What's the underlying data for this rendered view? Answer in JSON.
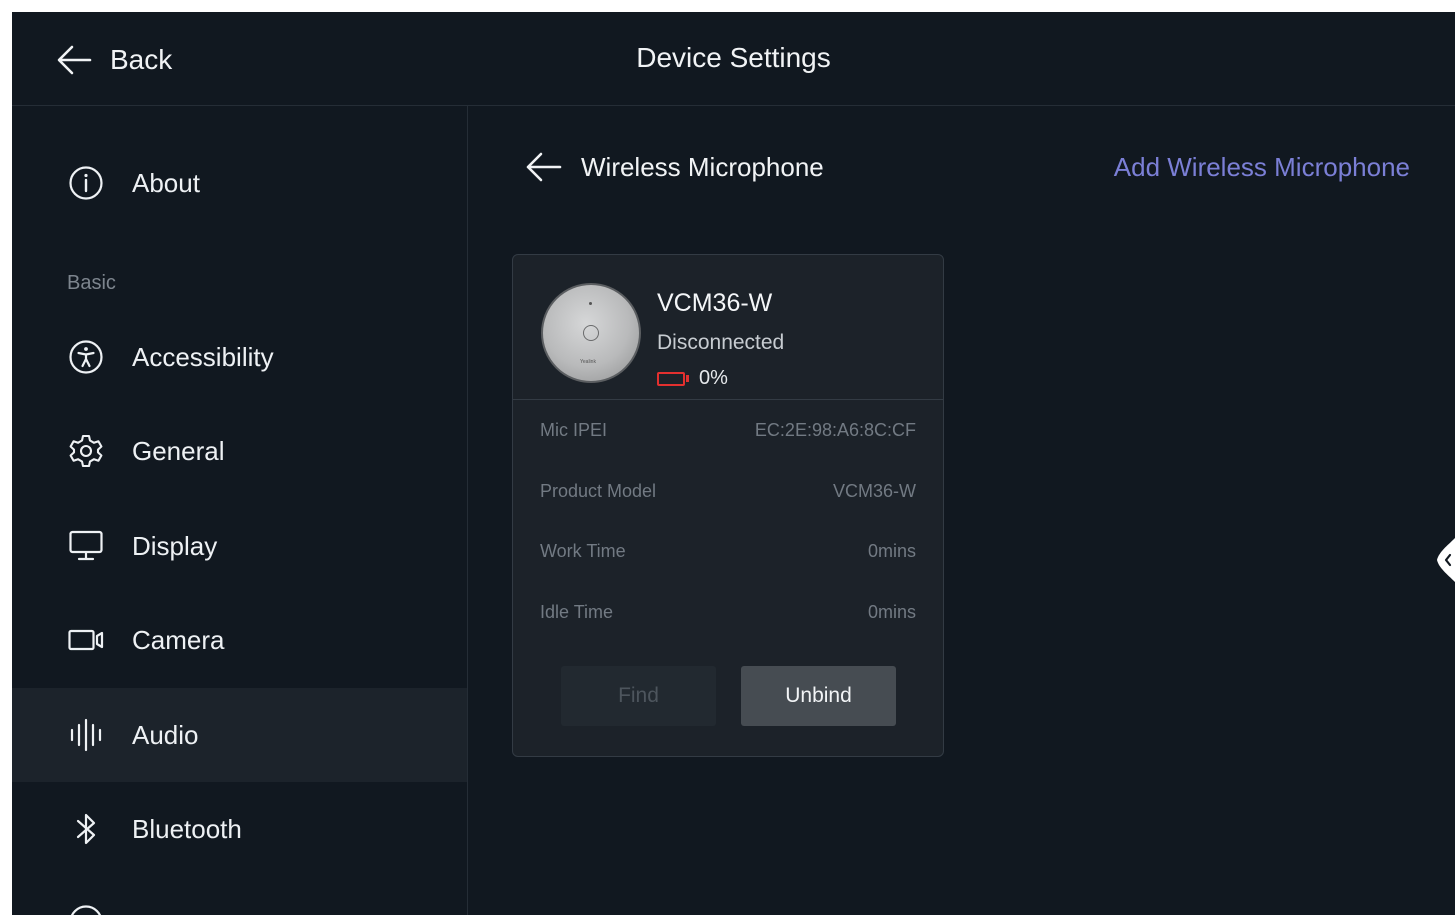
{
  "header": {
    "back_label": "Back",
    "title": "Device Settings"
  },
  "sidebar": {
    "items": [
      {
        "label": "About",
        "icon": "info-icon"
      },
      {
        "label": "Accessibility",
        "icon": "accessibility-icon"
      },
      {
        "label": "General",
        "icon": "gear-icon"
      },
      {
        "label": "Display",
        "icon": "monitor-icon"
      },
      {
        "label": "Camera",
        "icon": "camera-icon"
      },
      {
        "label": "Audio",
        "icon": "audio-waveform-icon",
        "active": true
      },
      {
        "label": "Bluetooth",
        "icon": "bluetooth-icon"
      }
    ],
    "section_basic": "Basic"
  },
  "main": {
    "title": "Wireless Microphone",
    "add_label": "Add Wireless Microphone",
    "device": {
      "name": "VCM36-W",
      "status": "Disconnected",
      "battery_percent": 0,
      "battery_text": "0%",
      "brand_text": "Yealink",
      "info": [
        {
          "label": "Mic IPEI",
          "value": "EC:2E:98:A6:8C:CF"
        },
        {
          "label": "Product Model",
          "value": "VCM36-W"
        },
        {
          "label": "Work Time",
          "value": "0mins"
        },
        {
          "label": "Idle Time",
          "value": "0mins"
        }
      ],
      "find_label": "Find",
      "unbind_label": "Unbind"
    }
  },
  "colors": {
    "background": "#111820",
    "sidebar_active": "#1c232b",
    "accent_link": "#7b7fd6",
    "battery_low": "#e3302f"
  }
}
